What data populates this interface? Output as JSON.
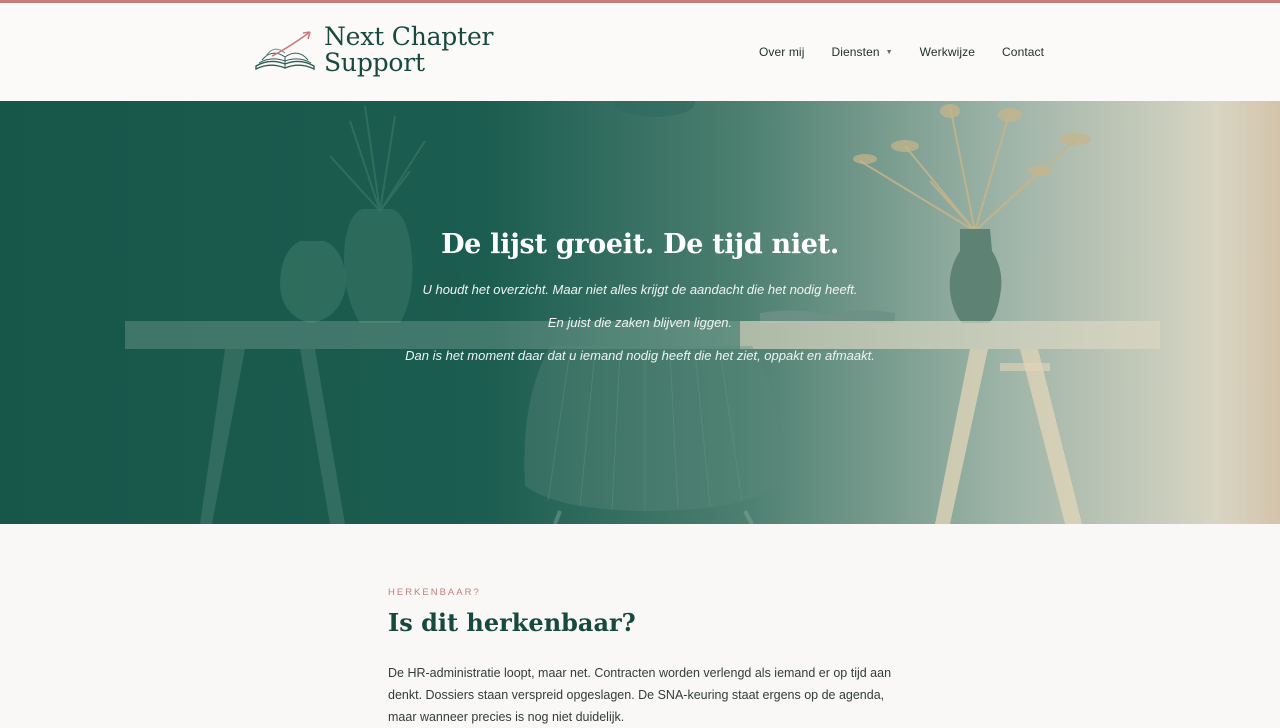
{
  "brand": {
    "line1": "Next Chapter",
    "line2": "Support",
    "icon": "book-arrow-logo",
    "color": "#17493f"
  },
  "nav": {
    "items": [
      {
        "label": "Over mij"
      },
      {
        "label": "Diensten",
        "has_dropdown": true
      },
      {
        "label": "Werkwijze"
      },
      {
        "label": "Contact"
      }
    ]
  },
  "hero": {
    "title": "De lijst groeit. De tijd niet.",
    "line1": "U houdt het overzicht. Maar niet alles krijgt de aandacht die het nodig heeft.",
    "line2": "En juist die zaken blijven liggen.",
    "line3": "Dan is het moment daar dat u iemand nodig heeft die het ziet, oppakt en afmaakt.",
    "overlay_color": "#17574a"
  },
  "section": {
    "eyebrow": "HERKENBAAR?",
    "title": "Is dit herkenbaar?",
    "body": "De HR-administratie loopt, maar net. Contracten worden verlengd als iemand er op tijd aan denkt. Dossiers staan verspreid opgeslagen. De SNA-keuring staat ergens op de agenda, maar wanneer precies is nog niet duidelijk."
  },
  "colors": {
    "accent": "#c97b7e",
    "heading": "#17493f",
    "background": "#faf8f6"
  }
}
